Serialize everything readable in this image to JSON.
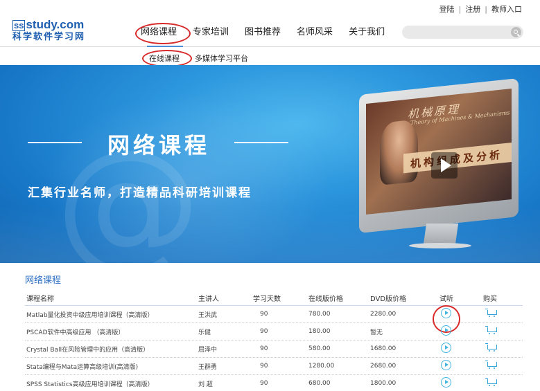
{
  "header": {
    "logo": {
      "line1_prefix": "ss",
      "line1_rest": "study.com",
      "line2": "科学软件学习网"
    },
    "top_links": [
      "登陆",
      "注册",
      "教师入口"
    ],
    "nav": [
      "网络课程",
      "专家培训",
      "图书推荐",
      "名师风采",
      "关于我们"
    ],
    "active_nav": "网络课程",
    "search": {
      "placeholder": "",
      "icon": "search-icon"
    }
  },
  "subnav": [
    "在线课程",
    "多媒体学习平台"
  ],
  "banner": {
    "title": "网络课程",
    "subtitle": "汇集行业名师，打造精品科研培训课程",
    "video_caption": "机械原理",
    "video_caption_en": "Theory of Machines & Mechanisms",
    "video_caption2": "机构组成及分析"
  },
  "courses": {
    "section_title": "网络课程",
    "headers": [
      "课程名称",
      "主讲人",
      "学习天数",
      "在线版价格",
      "DVD版价格",
      "试听",
      "购买"
    ],
    "rows": [
      {
        "name": "Matlab量化投资中级应用培训课程（高清版）",
        "lecturer": "王洪武",
        "days": "90",
        "online": "780.00",
        "dvd": "2280.00"
      },
      {
        "name": "PSCAD软件中高级应用 （高清版）",
        "lecturer": "乐健",
        "days": "90",
        "online": "180.00",
        "dvd": "暂无"
      },
      {
        "name": "Crystal Ball在风险管理中的应用（高清版）",
        "lecturer": "屈泽中",
        "days": "90",
        "online": "580.00",
        "dvd": "1680.00"
      },
      {
        "name": "Stata编程与Mata运算高级培训(高清版)",
        "lecturer": "王群勇",
        "days": "90",
        "online": "1280.00",
        "dvd": "2680.00"
      },
      {
        "name": "SPSS Statistics高级应用培训课程（高清版）",
        "lecturer": "刘 超",
        "days": "90",
        "online": "680.00",
        "dvd": "1800.00"
      }
    ]
  },
  "colors": {
    "brand": "#1f5fb0",
    "accent": "#2d6fc1",
    "highlight_circle": "#d82a2a",
    "icon": "#41b4e0"
  }
}
